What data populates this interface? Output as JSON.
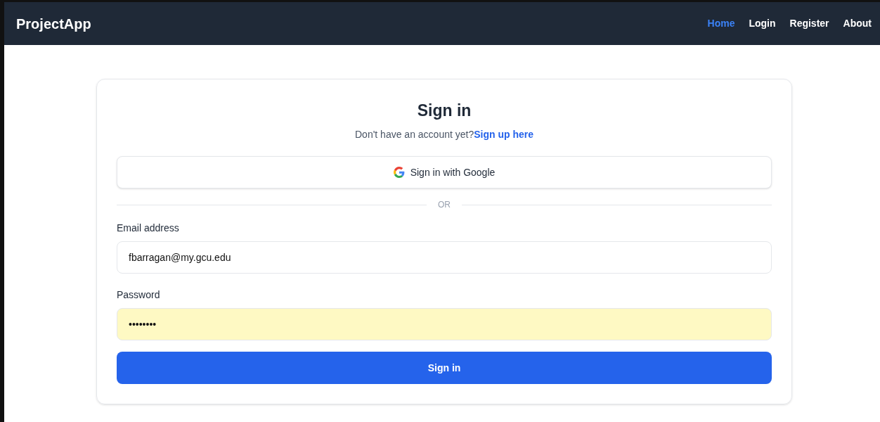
{
  "navbar": {
    "brand": "ProjectApp",
    "links": [
      {
        "label": "Home",
        "selected": true
      },
      {
        "label": "Login",
        "selected": false
      },
      {
        "label": "Register",
        "selected": false
      },
      {
        "label": "About",
        "selected": false
      }
    ]
  },
  "card": {
    "title": "Sign in",
    "prompt": "Don't have an account yet?",
    "prompt_link": "Sign up here",
    "google_button": "Sign in with Google",
    "divider": "OR",
    "fields": [
      {
        "label": "Email address",
        "value": "fbarragan@my.gcu.edu",
        "autofilled": false
      },
      {
        "label": "Password",
        "value": "••••••••",
        "autofilled": true
      }
    ],
    "submit": "Sign in"
  }
}
